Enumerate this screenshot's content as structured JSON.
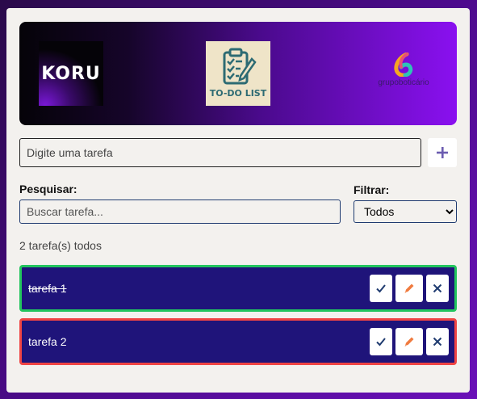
{
  "header": {
    "koru_logo_text": "KORU",
    "todo_logo_text": "TO-DO LIST",
    "brand_caption": "grupoboticário"
  },
  "new_task": {
    "placeholder": "Digite uma tarefa",
    "add_icon": "plus-icon"
  },
  "search": {
    "label": "Pesquisar:",
    "placeholder": "Buscar tarefa..."
  },
  "filter": {
    "label": "Filtrar:",
    "selected": "Todos"
  },
  "summary": "2 tarefa(s) todos",
  "tasks": [
    {
      "text": "tarefa 1",
      "status": "done",
      "border_color": "#22c55e"
    },
    {
      "text": "tarefa 2",
      "status": "pending",
      "border_color": "#ef4444"
    }
  ],
  "task_actions": {
    "complete_icon": "check-icon",
    "edit_icon": "pencil-icon",
    "delete_icon": "close-icon"
  },
  "colors": {
    "task_bg": "#1f147a",
    "accent_purple": "#8a10f0",
    "edit_orange": "#f07b3f",
    "icon_navy": "#1f3b70"
  }
}
